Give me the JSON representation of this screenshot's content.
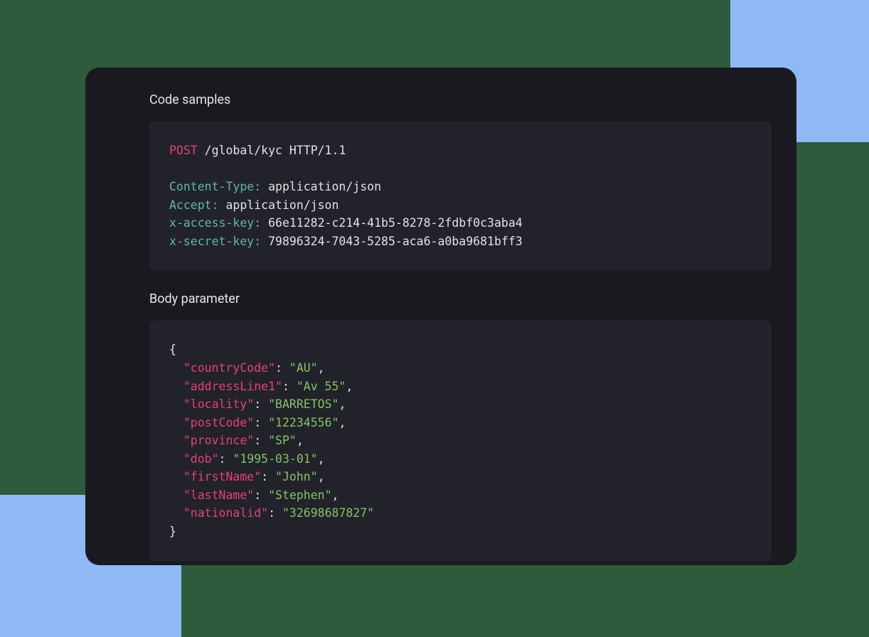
{
  "headings": {
    "codeSamples": "Code samples",
    "bodyParameter": "Body parameter"
  },
  "http": {
    "method": "POST",
    "pathAndVersion": " /global/kyc HTTP/1.1",
    "headers": {
      "contentTypeLabel": "Content-Type:",
      "contentTypeValue": " application/json",
      "acceptLabel": "Accept:",
      "acceptValue": " application/json",
      "xAccessKeyLabel": "x-access-key:",
      "xAccessKeyValue": " 66e11282-c214-41b5-8278-2fdbf0c3aba4",
      "xSecretKeyLabel": "x-secret-key:",
      "xSecretKeyValue": " 79896324-7043-5285-aca6-a0ba9681bff3"
    }
  },
  "body": {
    "open": "{",
    "close": "}",
    "pad": "  ",
    "colon": ": ",
    "comma": ",",
    "fields": [
      {
        "key": "\"countryCode\"",
        "value": "\"AU\""
      },
      {
        "key": "\"addressLine1\"",
        "value": "\"Av 55\""
      },
      {
        "key": "\"locality\"",
        "value": "\"BARRETOS\""
      },
      {
        "key": "\"postCode\"",
        "value": "\"12234556\""
      },
      {
        "key": "\"province\"",
        "value": "\"SP\""
      },
      {
        "key": "\"dob\"",
        "value": "\"1995-03-01\""
      },
      {
        "key": "\"firstName\"",
        "value": "\"John\""
      },
      {
        "key": "\"lastName\"",
        "value": "\"Stephen\""
      },
      {
        "key": "\"nationalid\"",
        "value": "\"32698687827\""
      }
    ]
  }
}
